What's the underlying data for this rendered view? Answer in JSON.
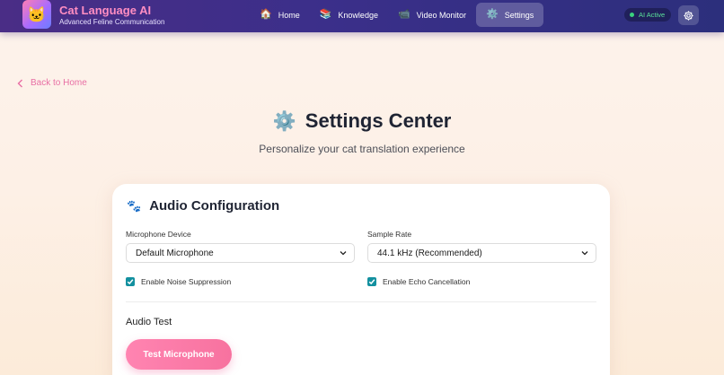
{
  "app": {
    "title": "Cat Language AI",
    "subtitle": "Advanced Feline Communication",
    "logo_glyph": "🐱"
  },
  "nav": {
    "items": [
      {
        "label": "Home",
        "icon": "🏠",
        "icon_name": "home-icon",
        "active": false
      },
      {
        "label": "Knowledge",
        "icon": "📚",
        "icon_name": "books-icon",
        "active": false
      },
      {
        "label": "Video Monitor",
        "icon": "📹",
        "icon_name": "video-camera-icon",
        "active": false
      },
      {
        "label": "Settings",
        "icon": "⚙️",
        "icon_name": "gear-icon",
        "active": true
      }
    ]
  },
  "status": {
    "label": "AI Active",
    "color": "#3ad17e"
  },
  "back_link": {
    "label": "Back to Home"
  },
  "page": {
    "icon": "⚙️",
    "title": "Settings Center",
    "subtitle": "Personalize your cat translation experience"
  },
  "audio": {
    "heading": "Audio Configuration",
    "heading_icon": "🐾",
    "microphone": {
      "label": "Microphone Device",
      "value": "Default Microphone"
    },
    "sample_rate": {
      "label": "Sample Rate",
      "value": "44.1 kHz (Recommended)"
    },
    "noise_suppression": {
      "label": "Enable Noise Suppression",
      "checked": true
    },
    "echo_cancellation": {
      "label": "Enable Echo Cancellation",
      "checked": true
    },
    "test_section": {
      "label": "Audio Test",
      "button": "Test Microphone"
    }
  },
  "colors": {
    "header_start": "#4a2d86",
    "header_end": "#2c2f7c",
    "accent_pink": "#ff84b1",
    "checkbox_teal": "#13909f",
    "brand_pink": "#ff8ec2"
  }
}
